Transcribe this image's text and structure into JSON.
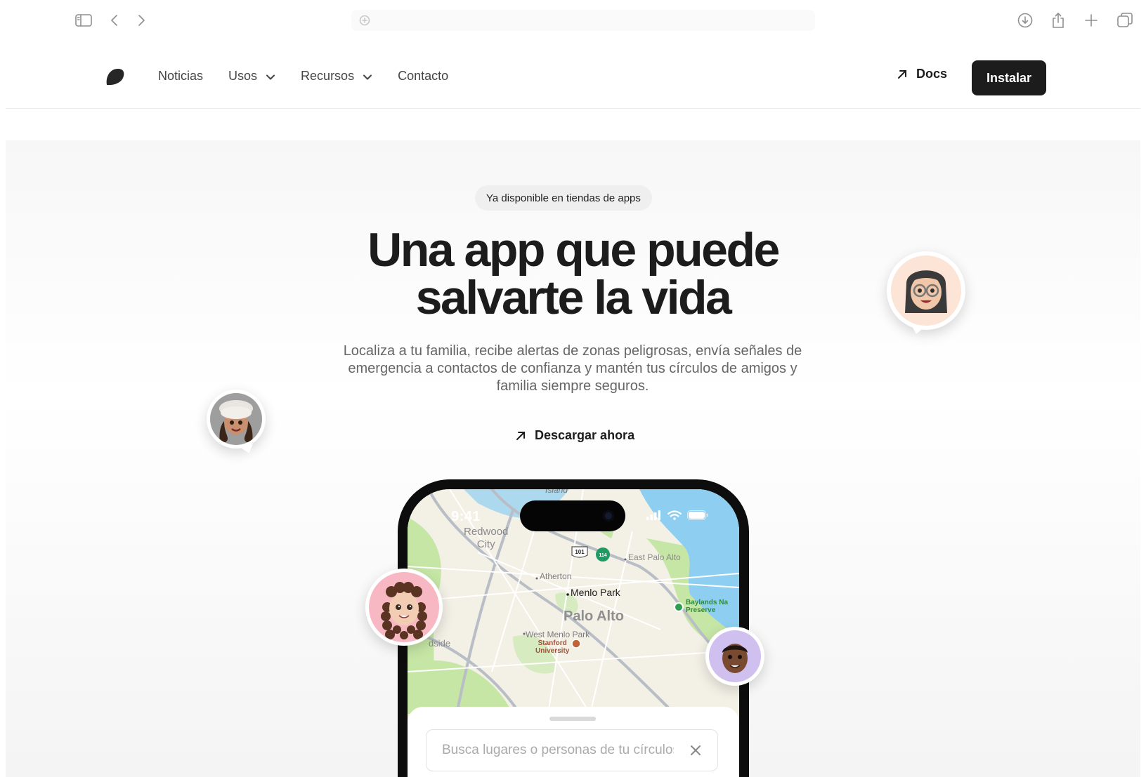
{
  "browser": {
    "icons": [
      "sidebar-icon",
      "back-icon",
      "forward-icon",
      "site-settings-icon",
      "download-icon",
      "share-icon",
      "new-tab-icon",
      "tabs-overview-icon"
    ]
  },
  "nav": {
    "items": [
      {
        "label": "Noticias",
        "dropdown": false
      },
      {
        "label": "Usos",
        "dropdown": true
      },
      {
        "label": "Recursos",
        "dropdown": true
      },
      {
        "label": "Contacto",
        "dropdown": false
      }
    ],
    "docs_label": "Docs",
    "install_label": "Instalar"
  },
  "hero": {
    "badge": "Ya disponible en tiendas de apps",
    "headline_line1": "Una app que puede",
    "headline_line2": "salvarte la vida",
    "subtitle": "Localiza a tu familia, recibe alertas de zonas peligrosas, envía señales de emergencia a contactos de confianza y mantén tus círculos de amigos y familia siempre seguros.",
    "cta_label": "Descargar ahora"
  },
  "phone": {
    "time": "9:41",
    "search_placeholder": "Busca lugares o personas de tu círculos...",
    "map_labels": {
      "island": "Island",
      "redwood_city": "Redwood City",
      "redwood_city_l1": "Redwood",
      "redwood_city_l2": "City",
      "east_palo_alto": "East Palo Alto",
      "atherton": "Atherton",
      "menlo_park": "Menlo Park",
      "palo_alto": "Palo Alto",
      "baylands_l1": "Baylands Na",
      "baylands_l2": "Preserve",
      "west_menlo_park": "West Menlo Park",
      "stanford_l1": "Stanford",
      "stanford_l2": "University",
      "woodside": "dside",
      "route_101": "101",
      "route_114": "114"
    }
  },
  "colors": {
    "accent": "#1c1c1c",
    "map_water": "#8ecff1",
    "map_park": "#c6e6a6",
    "map_land": "#f3f0e6"
  }
}
